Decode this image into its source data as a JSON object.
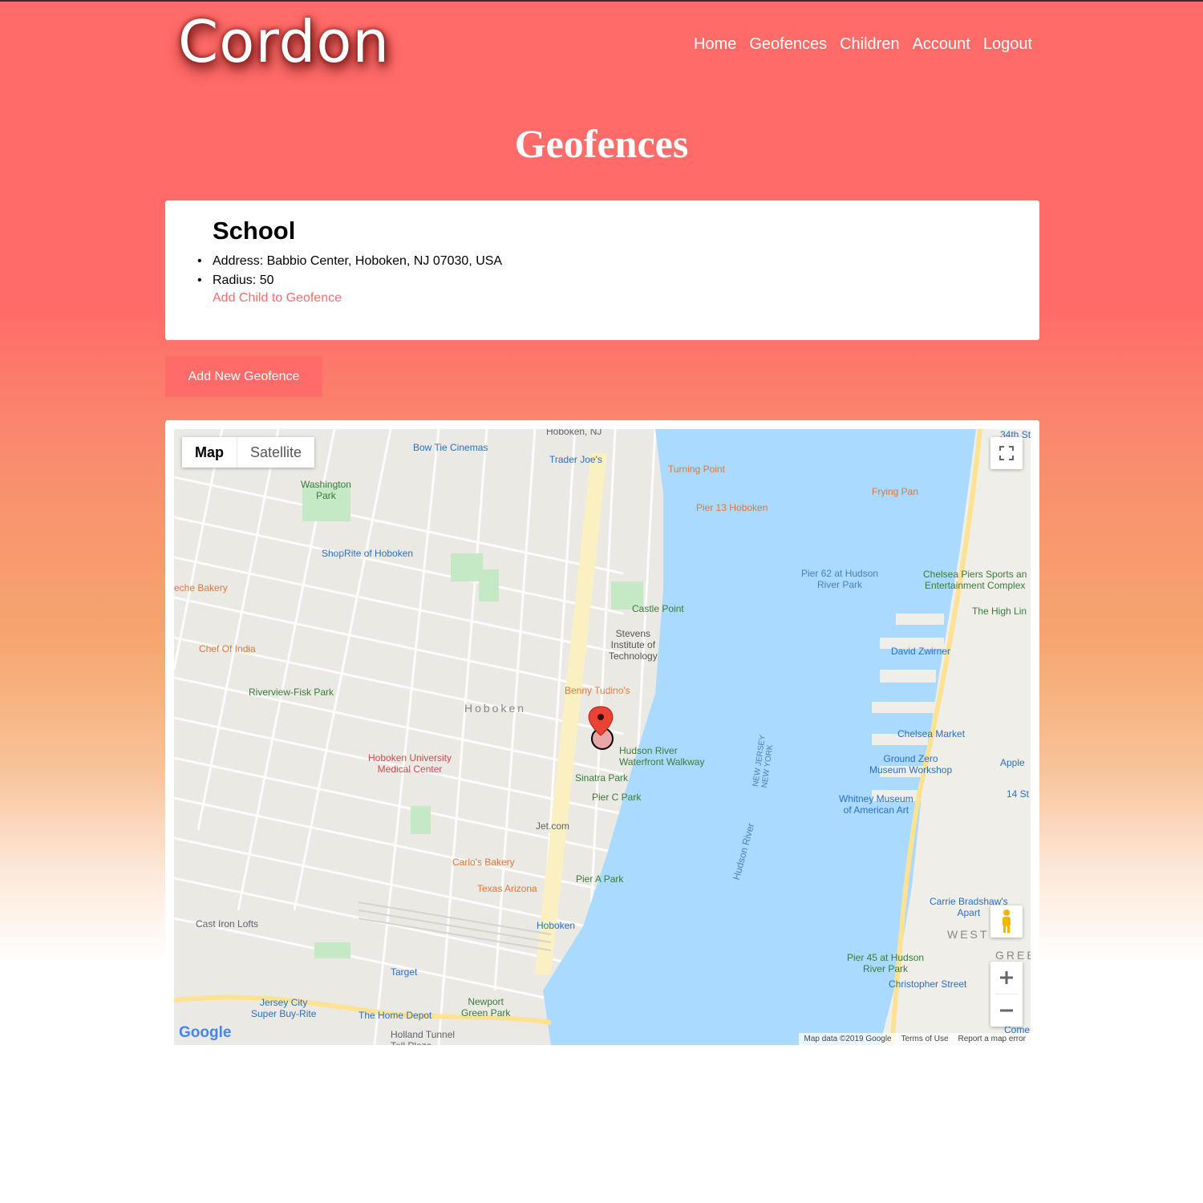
{
  "app": {
    "logo": "Cordon"
  },
  "nav": {
    "items": [
      "Home",
      "Geofences",
      "Children",
      "Account",
      "Logout"
    ]
  },
  "page": {
    "title": "Geofences"
  },
  "geofence": {
    "name": "School",
    "address": "Address: Babbio Center, Hoboken, NJ 07030, USA",
    "radius": "Radius: 50",
    "add_child_link": "Add Child to Geofence"
  },
  "actions": {
    "add_new": "Add New Geofence"
  },
  "map": {
    "type_buttons": {
      "map": "Map",
      "satellite": "Satellite"
    },
    "footer": {
      "data": "Map data ©2019 Google",
      "terms": "Terms of Use",
      "report": "Report a map error"
    },
    "google": "Google",
    "labels": {
      "hoboken_nj": "Hoboken, NJ",
      "bow_tie": "Bow Tie Cinemas",
      "trader_joes": "Trader Joe's",
      "turning_point": "Turning Point",
      "pier13": "Pier 13 Hoboken",
      "frying_pan": "Frying Pan",
      "washington_park": "Washington\nPark",
      "shoprite": "ShopRite of Hoboken",
      "pier62": "Pier 62 at Hudson\nRiver Park",
      "chelsea_piers": "Chelsea Piers Sports an\nEntertainment Complex",
      "high_line": "The High Lin",
      "castle_point": "Castle Point",
      "stevens": "Stevens\nInstitute of\nTechnology",
      "david_zwirner": "David Zwirner",
      "chef_india": "Chef Of India",
      "che_bakery": "eche Bakery",
      "riverview": "Riverview-Fisk Park",
      "benny": "Benny Tudino's",
      "hoboken": "Hoboken",
      "chelsea_market": "Chelsea Market",
      "hudson_walkway": "Hudson River\nWaterfront Walkway",
      "hoboken_hospital": "Hoboken University\nMedical Center",
      "sinatra": "Sinatra Park",
      "pier_c": "Pier C Park",
      "ground_zero": "Ground Zero\nMuseum Workshop",
      "apple": "Apple",
      "st14": "14 St",
      "whitney": "Whitney Museum\nof American Art",
      "jet": "Jet.com",
      "carlos": "Carlo's Bakery",
      "texas": "Texas Arizona",
      "pier_a": "Pier A Park",
      "carrie": "Carrie Bradshaw's\nApart",
      "cast_iron": "Cast Iron Lofts",
      "hoboken_term": "Hoboken",
      "west": "WEST",
      "gree": "GREE",
      "pier45": "Pier 45 at Hudson\nRiver Park",
      "christopher": "Christopher Street",
      "target": "Target",
      "jersey_city": "Jersey City\nSuper Buy-Rite",
      "home_depot": "The Home Depot",
      "newport": "Newport\nGreen Park",
      "holland": "Holland Tunnel\nToll Plaza",
      "hudson_river": "Hudson River",
      "nj_ny_1": "NEW JERSEY\nNEW YORK",
      "come": "Come",
      "st34": "34th St-"
    }
  },
  "colors": {
    "accent": "#ff6b68",
    "water": "#aadaff",
    "park": "#c5e8c5",
    "road": "#ffffff",
    "highway": "#fde293"
  }
}
